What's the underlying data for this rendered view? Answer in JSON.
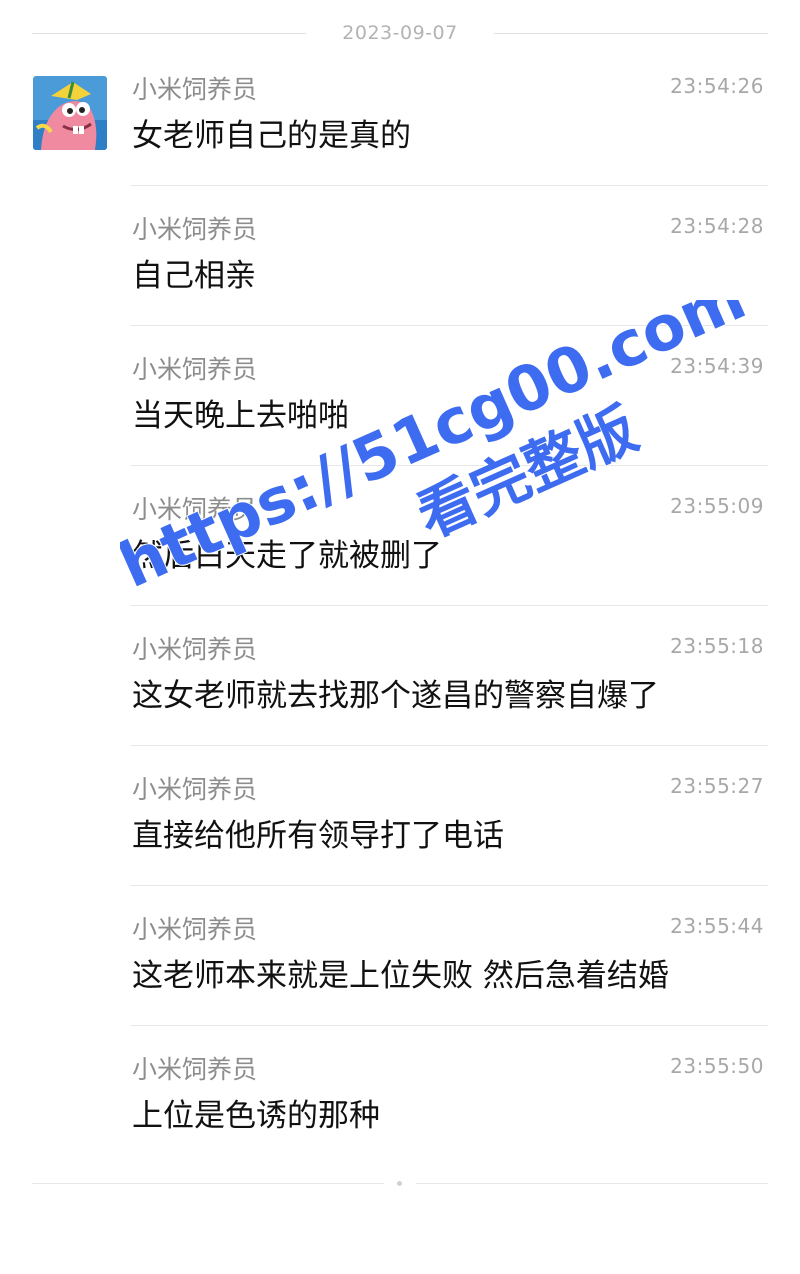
{
  "chat": {
    "date": "2023-09-07",
    "messages": [
      {
        "sender": "小米饲养员",
        "time": "23:54:26",
        "text": "女老师自己的是真的"
      },
      {
        "sender": "小米饲养员",
        "time": "23:54:28",
        "text": "自己相亲"
      },
      {
        "sender": "小米饲养员",
        "time": "23:54:39",
        "text": "当天晚上去啪啪"
      },
      {
        "sender": "小米饲养员",
        "time": "23:55:09",
        "text": "然后白天走了就被删了"
      },
      {
        "sender": "小米饲养员",
        "time": "23:55:18",
        "text": "这女老师就去找那个遂昌的警察自爆了"
      },
      {
        "sender": "小米饲养员",
        "time": "23:55:27",
        "text": "直接给他所有领导打了电话"
      },
      {
        "sender": "小米饲养员",
        "time": "23:55:44",
        "text": "这老师本来就是上位失败 然后急着结婚"
      },
      {
        "sender": "小米饲养员",
        "time": "23:55:50",
        "text": "上位是色诱的那种"
      }
    ]
  },
  "watermark": {
    "url": "https://51cg00.com",
    "caption": "看完整版",
    "color": "#3d6cf0"
  },
  "avatar": {
    "icon": "cartoon-avatar-icon"
  }
}
